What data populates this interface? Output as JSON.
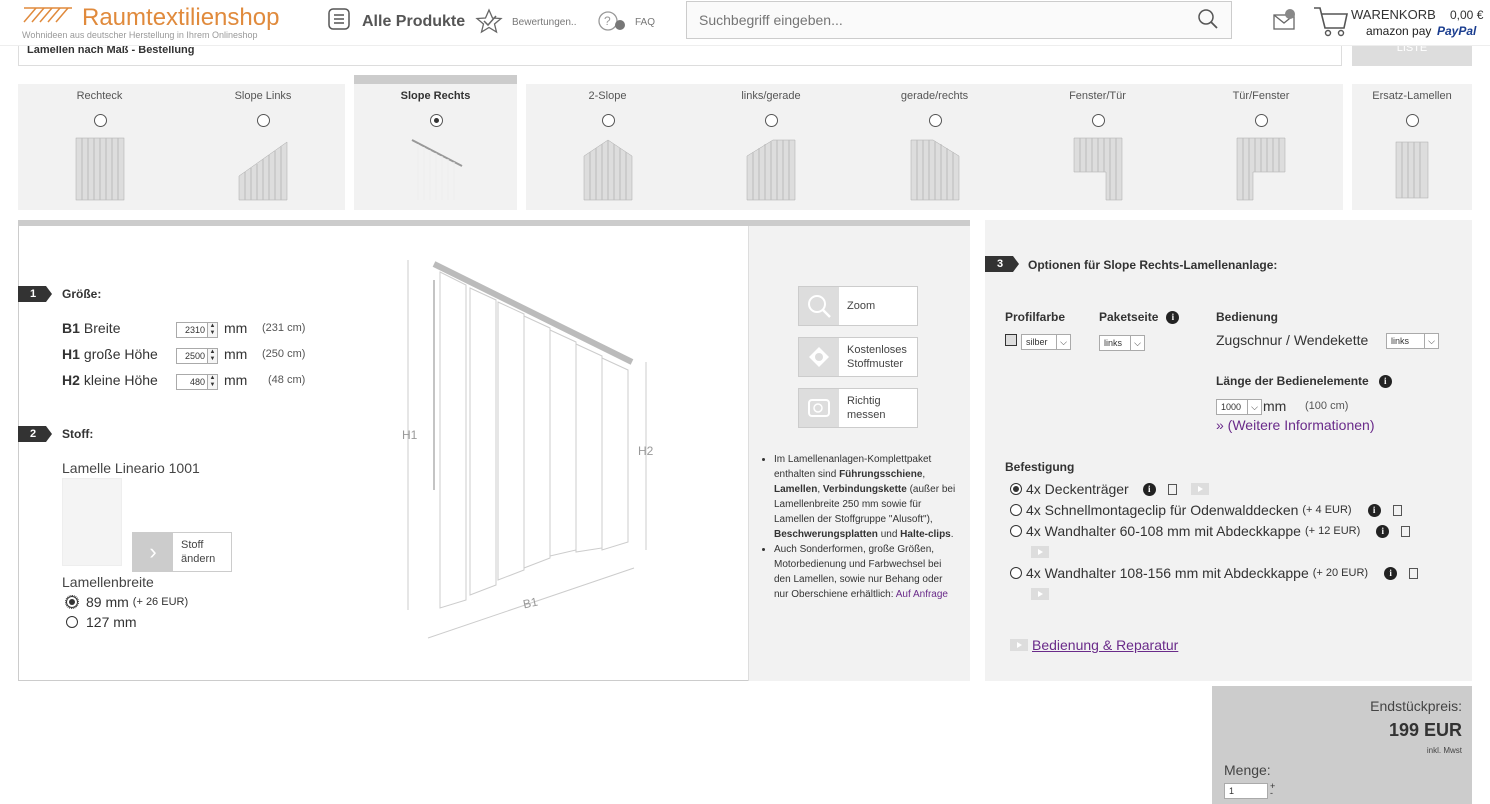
{
  "header": {
    "logo_text": "Raumtextilienshop",
    "logo_tagline": "Wohnideen aus deutscher Herstellung in Ihrem Onlineshop",
    "all_products": "Alle Produkte",
    "reviews": "Bewertungen..",
    "faq": "FAQ",
    "search_placeholder": "Suchbegriff eingeben...",
    "cart_label": "WARENKORB",
    "cart_amount": "0,00 €",
    "amazon_pay": "amazon pay",
    "paypal": "PayPal"
  },
  "subbar": {
    "title": "Lamellen nach Maß - Bestellung",
    "button": "LISTE"
  },
  "shapes": [
    {
      "label": "Rechteck",
      "selected": false
    },
    {
      "label": "Slope Links",
      "selected": false
    },
    {
      "label": "Slope Rechts",
      "selected": true
    },
    {
      "label": "2-Slope",
      "selected": false
    },
    {
      "label": "links/gerade",
      "selected": false
    },
    {
      "label": "gerade/rechts",
      "selected": false
    },
    {
      "label": "Fenster/Tür",
      "selected": false
    },
    {
      "label": "Tür/Fenster",
      "selected": false
    },
    {
      "label": "Ersatz-Lamellen",
      "selected": false
    }
  ],
  "size": {
    "num": "1",
    "title": "Größe:",
    "rows": [
      {
        "code": "B1",
        "label": "Breite",
        "value": "2310",
        "unit": "mm",
        "cm": "(231 cm)"
      },
      {
        "code": "H1",
        "label": "große Höhe",
        "value": "2500",
        "unit": "mm",
        "cm": "(250 cm)"
      },
      {
        "code": "H2",
        "label": "kleine Höhe",
        "value": "480",
        "unit": "mm",
        "cm": "(48 cm)"
      }
    ]
  },
  "fabric": {
    "num": "2",
    "title": "Stoff:",
    "name": "Lamelle Lineario 1001",
    "change_button": "Stoff ändern",
    "width_title": "Lamellenbreite",
    "widths": [
      {
        "label": "89 mm",
        "extra": "(+ 26 EUR)",
        "selected": true
      },
      {
        "label": "127 mm",
        "extra": "",
        "selected": false
      }
    ]
  },
  "diagram": {
    "h1": "H1",
    "h2": "H2",
    "b1": "B1"
  },
  "info_buttons": {
    "zoom": "Zoom",
    "sample": "Kostenloses Stoffmuster",
    "measure": "Richtig messen"
  },
  "info_text": {
    "p1_a": "Im Lamellenanlagen-Komplettpaket enthalten sind ",
    "p1_b": "Führungsschiene",
    "p1_c": ", ",
    "p1_d": "Lamellen",
    "p1_e": ", ",
    "p1_f": "Verbindungskette",
    "p1_g": " (außer bei Lamellenbreite 250 mm sowie für Lamellen der Stoffgruppe \"Alusoft\"), ",
    "p1_h": "Beschwerungsplatten",
    "p1_i": " und ",
    "p1_j": "Halte-clips",
    "p1_k": ".",
    "p2": "Auch Sonderformen, große Größen, Motorbedienung und Farbwechsel bei den Lamellen, sowie nur Behang oder nur Oberschiene erhältlich: ",
    "p2_link": "Auf Anfrage"
  },
  "options": {
    "num": "3",
    "title": "Optionen für Slope Rechts-Lamellenanlage:",
    "profilfarbe_label": "Profilfarbe",
    "profilfarbe_value": "silber",
    "paketseite_label": "Paketseite",
    "paketseite_value": "links",
    "bedienung_label": "Bedienung",
    "bedienung_text": "Zugschnur / Wendekette",
    "bedienung_value": "links",
    "laenge_label": "Länge der Bedienelemente",
    "laenge_value": "1000",
    "laenge_unit": "mm",
    "laenge_cm": "(100 cm)",
    "more_link": "» (Weitere Informationen)",
    "befestigung_label": "Befestigung",
    "befestigung": [
      {
        "label": "4x Deckenträger",
        "extra": "",
        "selected": true
      },
      {
        "label": "4x Schnellmontageclip für Odenwalddecken",
        "extra": "(+ 4 EUR)",
        "selected": false
      },
      {
        "label": "4x Wandhalter 60-108 mm mit Abdeckkappe",
        "extra": "(+ 12 EUR)",
        "selected": false
      },
      {
        "label": "4x Wandhalter 108-156 mm mit Abdeckkappe",
        "extra": "(+ 20 EUR)",
        "selected": false
      }
    ],
    "repair_link": "Bedienung & Reparatur"
  },
  "price": {
    "label": "Endstückpreis:",
    "value": "199 EUR",
    "vat": "inkl. Mwst",
    "qty_label": "Menge:",
    "qty": "1"
  }
}
